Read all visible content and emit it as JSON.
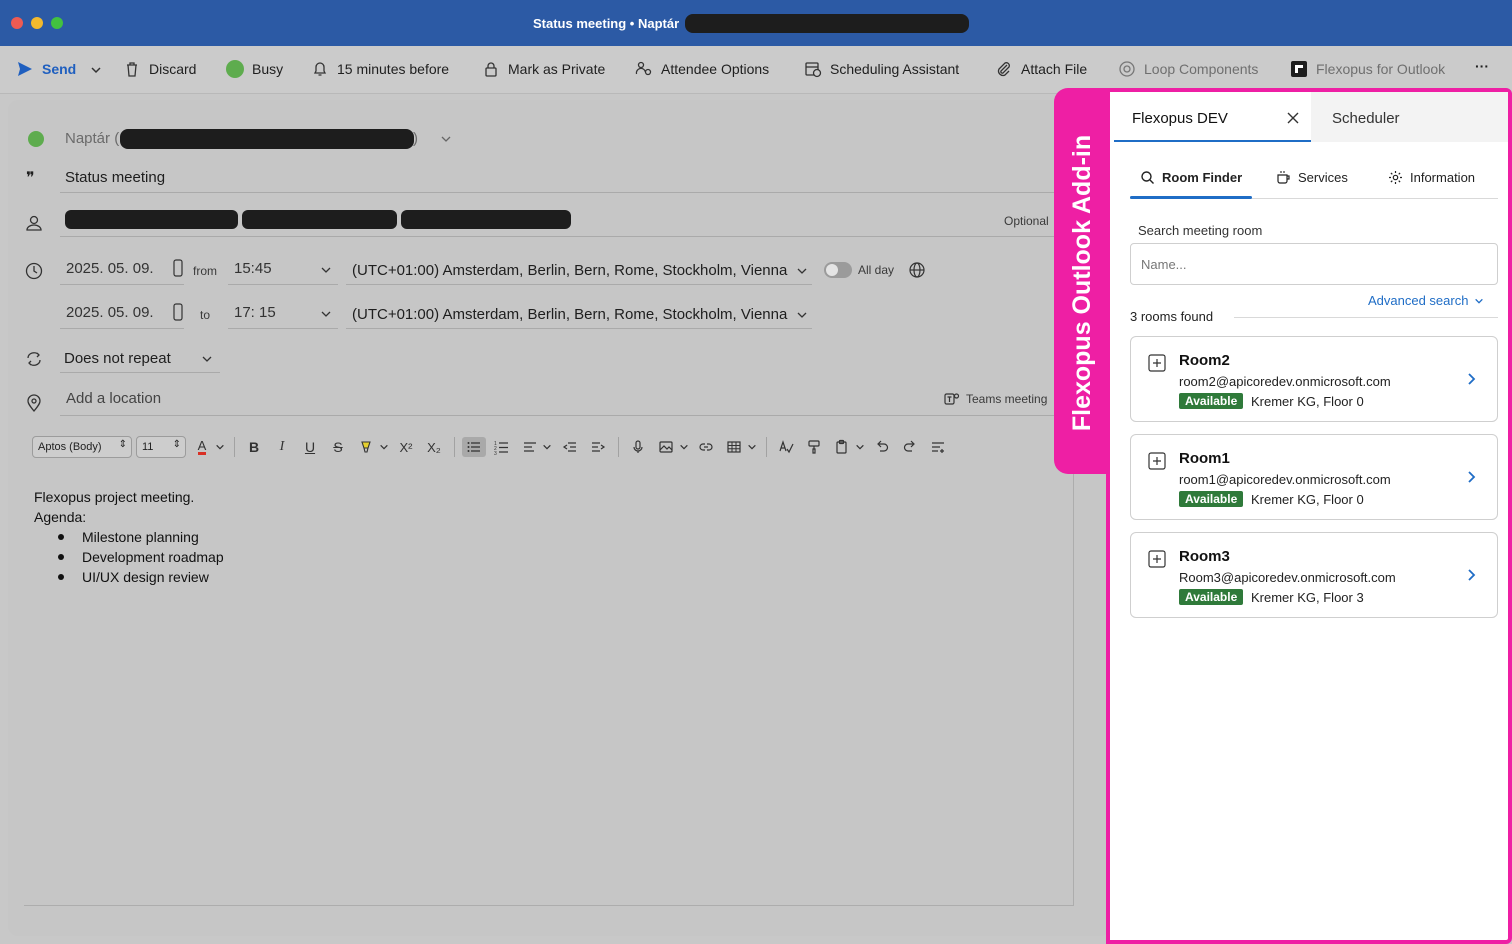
{
  "window": {
    "title": "Status meeting • Naptár"
  },
  "toolbar": {
    "send_label": "Send",
    "discard_label": "Discard",
    "busy_label": "Busy",
    "reminder_label": "15 minutes before",
    "private_label": "Mark as Private",
    "attendee_label": "Attendee Options",
    "scheduling_label": "Scheduling Assistant",
    "attach_label": "Attach File",
    "loop_label": "Loop Components",
    "flexopus_label": "Flexopus for Outlook",
    "more_label": "···"
  },
  "compose": {
    "calendar_label": "Naptár (",
    "calendar_close": ")",
    "subject": "Status meeting",
    "optional_label": "Optional",
    "start_date": "2025. 05. 09.",
    "from_label": "from",
    "start_time": "15:45",
    "timezone_start": "(UTC+01:00) Amsterdam, Berlin, Bern, Rome, Stockholm, Vienna",
    "allday_label": "All day",
    "end_date": "2025. 05. 09.",
    "to_label": "to",
    "end_time": "17: 15",
    "timezone_end": "(UTC+01:00) Amsterdam, Berlin, Bern, Rome, Stockholm, Vienna",
    "repeat_label": "Does not repeat",
    "location_placeholder": "Add a location",
    "teams_label": "Teams meeting"
  },
  "format": {
    "font_name": "Aptos (Body)",
    "font_size": "11"
  },
  "body": {
    "line1": "Flexopus project meeting.",
    "line2": "Agenda:",
    "items": [
      "Milestone planning",
      "Development roadmap",
      "UI/UX design review"
    ]
  },
  "addin": {
    "tag_label": "Flexopus Outlook Add-in",
    "tab_active": "Flexopus DEV",
    "tab_other": "Scheduler",
    "nav": {
      "room_finder": "Room Finder",
      "services": "Services",
      "information": "Information"
    },
    "search_label": "Search meeting room",
    "search_placeholder": "Name...",
    "advanced_search": "Advanced search",
    "rooms_found": "3 rooms found",
    "rooms": [
      {
        "name": "Room2",
        "email": "room2@apicoredev.onmicrosoft.com",
        "status": "Available",
        "location": "Kremer KG, Floor 0"
      },
      {
        "name": "Room1",
        "email": "room1@apicoredev.onmicrosoft.com",
        "status": "Available",
        "location": "Kremer KG, Floor 0"
      },
      {
        "name": "Room3",
        "email": "Room3@apicoredev.onmicrosoft.com",
        "status": "Available",
        "location": "Kremer KG, Floor 3"
      }
    ]
  },
  "colors": {
    "titlebar": "#2c5aa5",
    "accent": "#1f6dc6",
    "addin_highlight": "#ee1fa4",
    "available": "#2f7a3a",
    "busy": "#5eac4e"
  }
}
